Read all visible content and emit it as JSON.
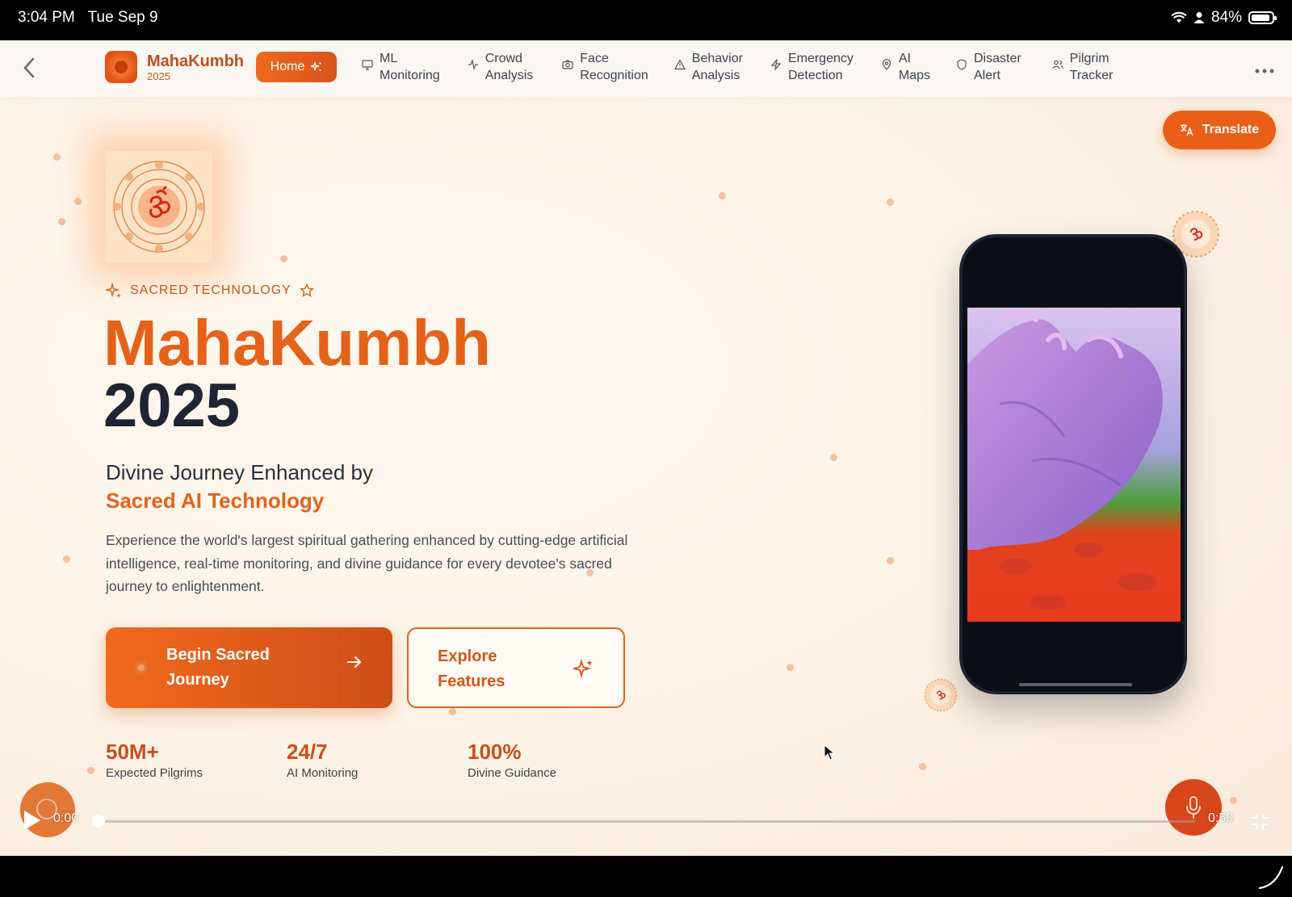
{
  "status_bar": {
    "time": "3:04 PM",
    "date": "Tue Sep 9",
    "battery": "84%"
  },
  "nav": {
    "brand_name": "MahaKumbh",
    "brand_year": "2025",
    "home_label": "Home",
    "items": [
      {
        "line1": "ML",
        "line2": "Monitoring",
        "icon": "monitor-icon"
      },
      {
        "line1": "Crowd",
        "line2": "Analysis",
        "icon": "activity-icon"
      },
      {
        "line1": "Face",
        "line2": "Recognition",
        "icon": "camera-icon"
      },
      {
        "line1": "Behavior",
        "line2": "Analysis",
        "icon": "warning-icon"
      },
      {
        "line1": "Emergency",
        "line2": "Detection",
        "icon": "zap-icon"
      },
      {
        "line1": "AI",
        "line2": "Maps",
        "icon": "map-pin-icon"
      },
      {
        "line1": "Disaster",
        "line2": "Alert",
        "icon": "shield-icon"
      },
      {
        "line1": "Pilgrim",
        "line2": "Tracker",
        "icon": "users-icon"
      }
    ]
  },
  "translate_label": "Translate",
  "hero": {
    "eyebrow": "SACRED TECHNOLOGY",
    "title": "MahaKumbh",
    "year": "2025",
    "subtitle_line1": "Divine Journey Enhanced by",
    "subtitle_line2": "Sacred AI Technology",
    "description": "Experience the world's largest spiritual gathering enhanced by cutting-edge artificial intelligence, real-time monitoring, and divine guidance for every devotee's sacred journey to enlightenment.",
    "cta_primary": "Begin Sacred Journey",
    "cta_secondary": "Explore Features"
  },
  "stats": [
    {
      "value": "50M+",
      "label": "Expected Pilgrims"
    },
    {
      "value": "24/7",
      "label": "AI Monitoring"
    },
    {
      "value": "100%",
      "label": "Divine Guidance"
    }
  ],
  "video": {
    "current_time": "0:00",
    "duration": "0:50",
    "progress": 0
  },
  "colors": {
    "accent": "#e5621a",
    "accent_dark": "#c8501d",
    "text_dark": "#1e2433",
    "background": "#fdf3e6"
  }
}
